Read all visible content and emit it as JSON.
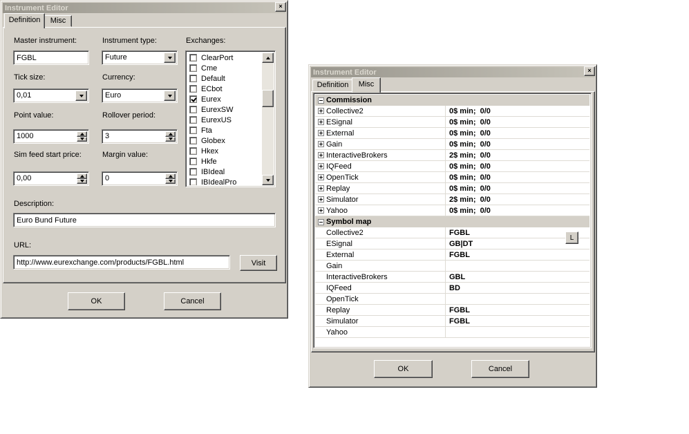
{
  "definition_dialog": {
    "title": "Instrument Editor",
    "close_label": "×",
    "tabs": {
      "definition": "Definition",
      "misc": "Misc"
    },
    "master_instrument_label": "Master instrument:",
    "master_instrument_value": "FGBL",
    "instrument_type_label": "Instrument type:",
    "instrument_type_value": "Future",
    "tick_size_label": "Tick size:",
    "tick_size_value": "0,01",
    "currency_label": "Currency:",
    "currency_value": "Euro",
    "point_value_label": "Point value:",
    "point_value_value": "1000",
    "rollover_label": "Rollover period:",
    "rollover_value": "3",
    "sim_feed_label": "Sim feed start price:",
    "sim_feed_value": "0,00",
    "margin_label": "Margin value:",
    "margin_value": "0",
    "exchanges_label": "Exchanges:",
    "exchanges": [
      {
        "name": "ClearPort",
        "checked": false
      },
      {
        "name": "Cme",
        "checked": false
      },
      {
        "name": "Default",
        "checked": false
      },
      {
        "name": "ECbot",
        "checked": false
      },
      {
        "name": "Eurex",
        "checked": true
      },
      {
        "name": "EurexSW",
        "checked": false
      },
      {
        "name": "EurexUS",
        "checked": false
      },
      {
        "name": "Fta",
        "checked": false
      },
      {
        "name": "Globex",
        "checked": false
      },
      {
        "name": "Hkex",
        "checked": false
      },
      {
        "name": "Hkfe",
        "checked": false
      },
      {
        "name": "IBIdeal",
        "checked": false
      },
      {
        "name": "IBIdealPro",
        "checked": false
      }
    ],
    "description_label": "Description:",
    "description_value": "Euro Bund Future",
    "url_label": "URL:",
    "url_value": "http://www.eurexchange.com/products/FGBL.html",
    "visit_button": "Visit",
    "ok_button": "OK",
    "cancel_button": "Cancel"
  },
  "misc_dialog": {
    "title": "Instrument Editor",
    "close_label": "×",
    "tabs": {
      "definition": "Definition",
      "misc": "Misc"
    },
    "sections": [
      {
        "name": "Commission",
        "rows": [
          {
            "name": "Collective2",
            "value": "0$ min;  0/0",
            "expandable": true
          },
          {
            "name": "ESignal",
            "value": "0$ min;  0/0",
            "expandable": true
          },
          {
            "name": "External",
            "value": "0$ min;  0/0",
            "expandable": true
          },
          {
            "name": "Gain",
            "value": "0$ min;  0/0",
            "expandable": true
          },
          {
            "name": "InteractiveBrokers",
            "value": "2$ min;  0/0",
            "expandable": true
          },
          {
            "name": "IQFeed",
            "value": "0$ min;  0/0",
            "expandable": true
          },
          {
            "name": "OpenTick",
            "value": "0$ min;  0/0",
            "expandable": true
          },
          {
            "name": "Replay",
            "value": "0$ min;  0/0",
            "expandable": true
          },
          {
            "name": "Simulator",
            "value": "2$ min;  0/0",
            "expandable": true
          },
          {
            "name": "Yahoo",
            "value": "0$ min;  0/0",
            "expandable": true
          }
        ]
      },
      {
        "name": "Symbol map",
        "rows": [
          {
            "name": "Collective2",
            "value": "FGBL",
            "expandable": false
          },
          {
            "name": "ESignal",
            "value": "GB|DT",
            "expandable": false
          },
          {
            "name": "External",
            "value": "FGBL",
            "expandable": false
          },
          {
            "name": "Gain",
            "value": "",
            "expandable": false
          },
          {
            "name": "InteractiveBrokers",
            "value": "GBL",
            "expandable": false
          },
          {
            "name": "IQFeed",
            "value": "BD",
            "expandable": false
          },
          {
            "name": "OpenTick",
            "value": "",
            "expandable": false
          },
          {
            "name": "Replay",
            "value": "FGBL",
            "expandable": false
          },
          {
            "name": "Simulator",
            "value": "FGBL",
            "expandable": false
          },
          {
            "name": "Yahoo",
            "value": "",
            "expandable": false
          }
        ]
      }
    ],
    "mini_button_label": "L",
    "ok_button": "OK",
    "cancel_button": "Cancel"
  }
}
